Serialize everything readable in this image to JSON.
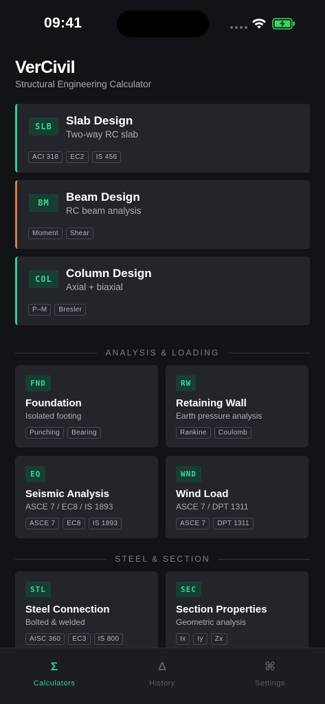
{
  "status_bar": {
    "time": "09:41"
  },
  "header": {
    "title": "VerCivil",
    "subtitle": "Structural Engineering Calculator"
  },
  "featured": [
    {
      "badge": "SLB",
      "title": "Slab Design",
      "subtitle": "Two-way RC slab",
      "tags": [
        "ACI 318",
        "EC2",
        "IS 456"
      ],
      "accent": "#2ecf93"
    },
    {
      "badge": "BM",
      "title": "Beam Design",
      "subtitle": "RC beam analysis",
      "tags": [
        "Moment",
        "Shear"
      ],
      "accent": "#d9794c"
    },
    {
      "badge": "COL",
      "title": "Column Design",
      "subtitle": "Axial + biaxial",
      "tags": [
        "P–M",
        "Bresler"
      ],
      "accent": "#2ecf93"
    }
  ],
  "sections": [
    {
      "label": "ANALYSIS & LOADING",
      "cards": [
        {
          "badge": "FND",
          "title": "Foundation",
          "subtitle": "Isolated footing",
          "tags": [
            "Punching",
            "Bearing"
          ]
        },
        {
          "badge": "RW",
          "title": "Retaining Wall",
          "subtitle": "Earth pressure analysis",
          "tags": [
            "Rankine",
            "Coulomb"
          ]
        },
        {
          "badge": "EQ",
          "title": "Seismic Analysis",
          "subtitle": "ASCE 7 / EC8 / IS 1893",
          "tags": [
            "ASCE 7",
            "EC8",
            "IS 1893"
          ]
        },
        {
          "badge": "WND",
          "title": "Wind Load",
          "subtitle": "ASCE 7 / DPT 1311",
          "tags": [
            "ASCE 7",
            "DPT 1311"
          ]
        }
      ]
    },
    {
      "label": "STEEL & SECTION",
      "cards": [
        {
          "badge": "STL",
          "title": "Steel Connection",
          "subtitle": "Bolted & welded",
          "tags": [
            "AISC 360",
            "EC3",
            "IS 800"
          ]
        },
        {
          "badge": "SEC",
          "title": "Section Properties",
          "subtitle": "Geometric analysis",
          "tags": [
            "Ix",
            "Iy",
            "Zx"
          ]
        }
      ]
    }
  ],
  "tabbar": [
    {
      "glyph": "Σ",
      "label": "Calculators",
      "active": true,
      "icon": "sigma-icon"
    },
    {
      "glyph": "Δ",
      "label": "History",
      "active": false,
      "icon": "delta-icon"
    },
    {
      "glyph": "⌘",
      "label": "Settings",
      "active": false,
      "icon": "command-icon"
    }
  ],
  "colors": {
    "accent": "#2ecf93",
    "beam_accent": "#d9794c",
    "background": "#121316",
    "card": "#23252b"
  }
}
